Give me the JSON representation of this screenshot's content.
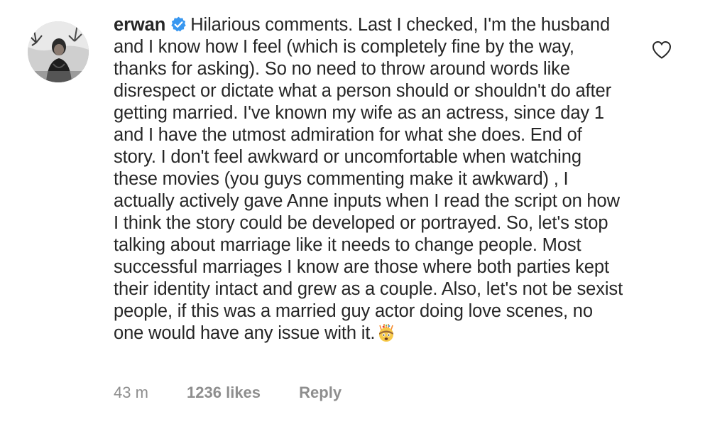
{
  "comment": {
    "username": "erwan",
    "verified_icon": "verified-badge-icon",
    "text": "Hilarious comments. Last I checked, I'm the husband and I know how I feel (which is completely fine by the way, thanks for asking). So no need to throw around words like disrespect or dictate what a person should or shouldn't do after getting married. I've known my wife as an actress, since day 1 and I have the utmost admiration for what she does. End of story. I don't feel awkward or uncomfortable when watching these movies (you guys commenting make it awkward) , I actually actively gave Anne inputs when I read the script on how I think the story could be developed or portrayed. So, let's stop talking about marriage like it needs to change people. Most successful marriages I know are those where both parties kept their identity intact and grew as a couple. Also, let's not be sexist people, if this was a married guy actor doing love scenes, no one would have any issue with it.",
    "emoji": "exploding-head-emoji-icon",
    "timestamp": "43 m",
    "likes": "1236 likes",
    "reply_label": "Reply",
    "like_icon": "heart-outline-icon"
  },
  "colors": {
    "text": "#262626",
    "meta": "#8e8e8e",
    "verified_blue": "#3897f0",
    "background": "#ffffff"
  }
}
